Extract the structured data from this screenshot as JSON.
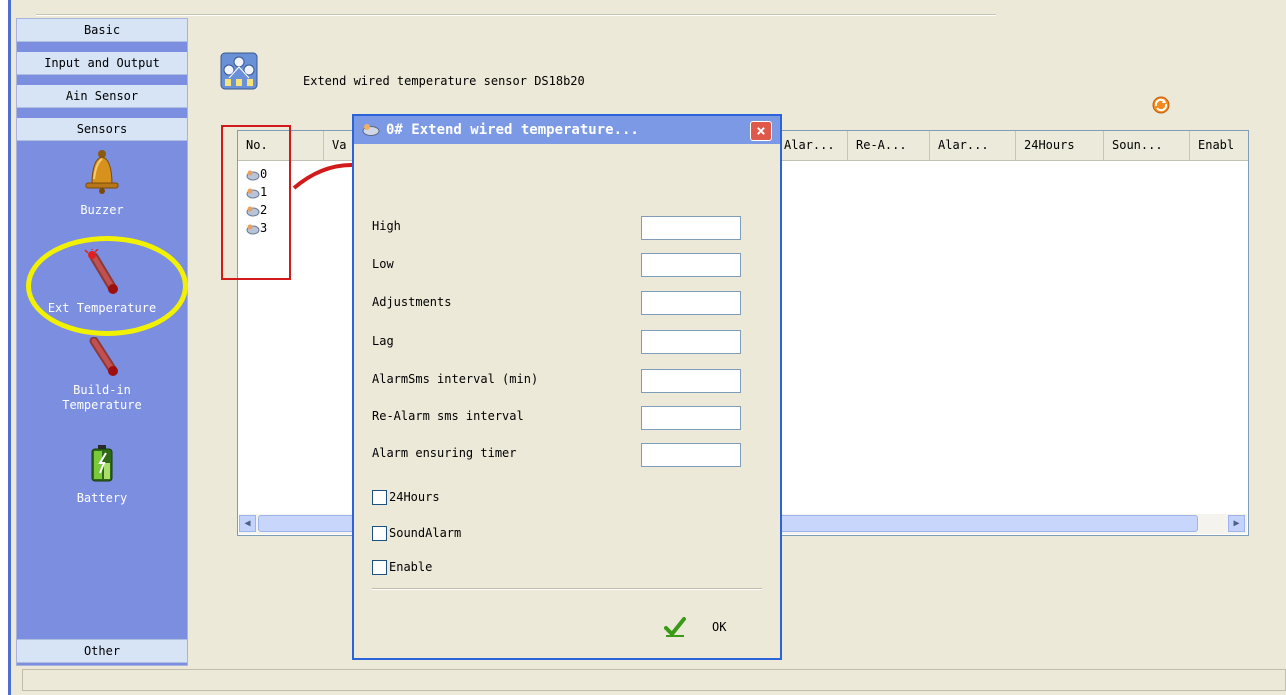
{
  "sidebar": {
    "categories": {
      "basic": "Basic",
      "input_output": "Input and Output",
      "ain_sensor": "Ain Sensor",
      "sensors": "Sensors",
      "other": "Other"
    },
    "items": [
      {
        "label": "Buzzer",
        "icon": "bell-icon"
      },
      {
        "label": "Ext Temperature",
        "icon": "thermometer-icon",
        "highlighted": true
      },
      {
        "label": "Build-in",
        "label2": "Temperature",
        "icon": "thermometer-icon"
      },
      {
        "label": "Battery",
        "icon": "battery-icon"
      }
    ]
  },
  "header": {
    "title": "Extend wired temperature sensor DS18b20"
  },
  "table": {
    "columns": [
      "No.",
      "Va",
      "Alar...",
      "Re-A...",
      "Alar...",
      "24Hours",
      "Soun...",
      "Enabl"
    ],
    "rows": [
      "0",
      "1",
      "2",
      "3"
    ]
  },
  "dialog": {
    "title": "0# Extend wired temperature...",
    "close_label": "×",
    "fields": [
      {
        "label": "High",
        "value": ""
      },
      {
        "label": "Low",
        "value": ""
      },
      {
        "label": "Adjustments",
        "value": ""
      },
      {
        "label": "Lag",
        "value": ""
      },
      {
        "label": "AlarmSms interval (min)",
        "value": ""
      },
      {
        "label": "Re-Alarm sms interval",
        "value": ""
      },
      {
        "label": "Alarm ensuring timer",
        "value": ""
      }
    ],
    "checkboxes": [
      {
        "label": "24Hours",
        "checked": false
      },
      {
        "label": "SoundAlarm",
        "checked": false
      },
      {
        "label": "Enable",
        "checked": false
      }
    ],
    "ok_label": "OK"
  },
  "colors": {
    "sidebar_bg": "#7b8ee0",
    "dialog_title_bg": "#7c99e6",
    "annotation_red": "#d21a1a",
    "highlight_yellow": "#f2f200"
  }
}
